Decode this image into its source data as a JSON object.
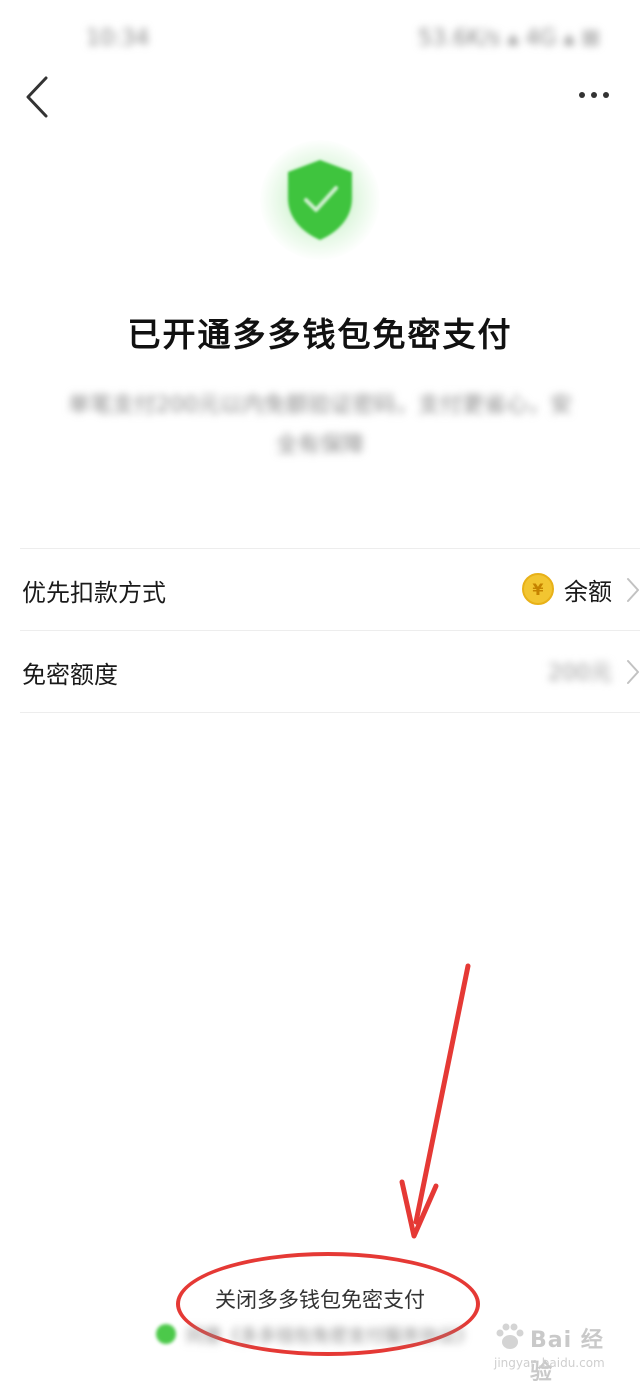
{
  "status_bar": {
    "time": "10:34",
    "indicators": "53.6K/s ▴ 4G ▴ ⊠"
  },
  "nav": {
    "back_icon": "chevron-left-icon",
    "more_icon": "more-horizontal-icon"
  },
  "header": {
    "title": "已开通多多钱包免密支付",
    "description": "单笔支付200元以内免额验证密码，支付更省心，安全有保障",
    "shield_icon": "shield-check-icon",
    "shield_color": "#3fc43e"
  },
  "settings": {
    "rows": [
      {
        "label": "优先扣款方式",
        "value": "余额",
        "icon": "coin-yen-icon"
      },
      {
        "label": "免密额度",
        "value": "200元"
      }
    ]
  },
  "footer": {
    "close_label": "关闭多多钱包免密支付",
    "agreement_text": "同意《多多钱包免密支付服务协议》",
    "annotation_color": "#e53935"
  },
  "watermark": {
    "brand": "Bai 经验",
    "url": "jingyan.baidu.com"
  }
}
